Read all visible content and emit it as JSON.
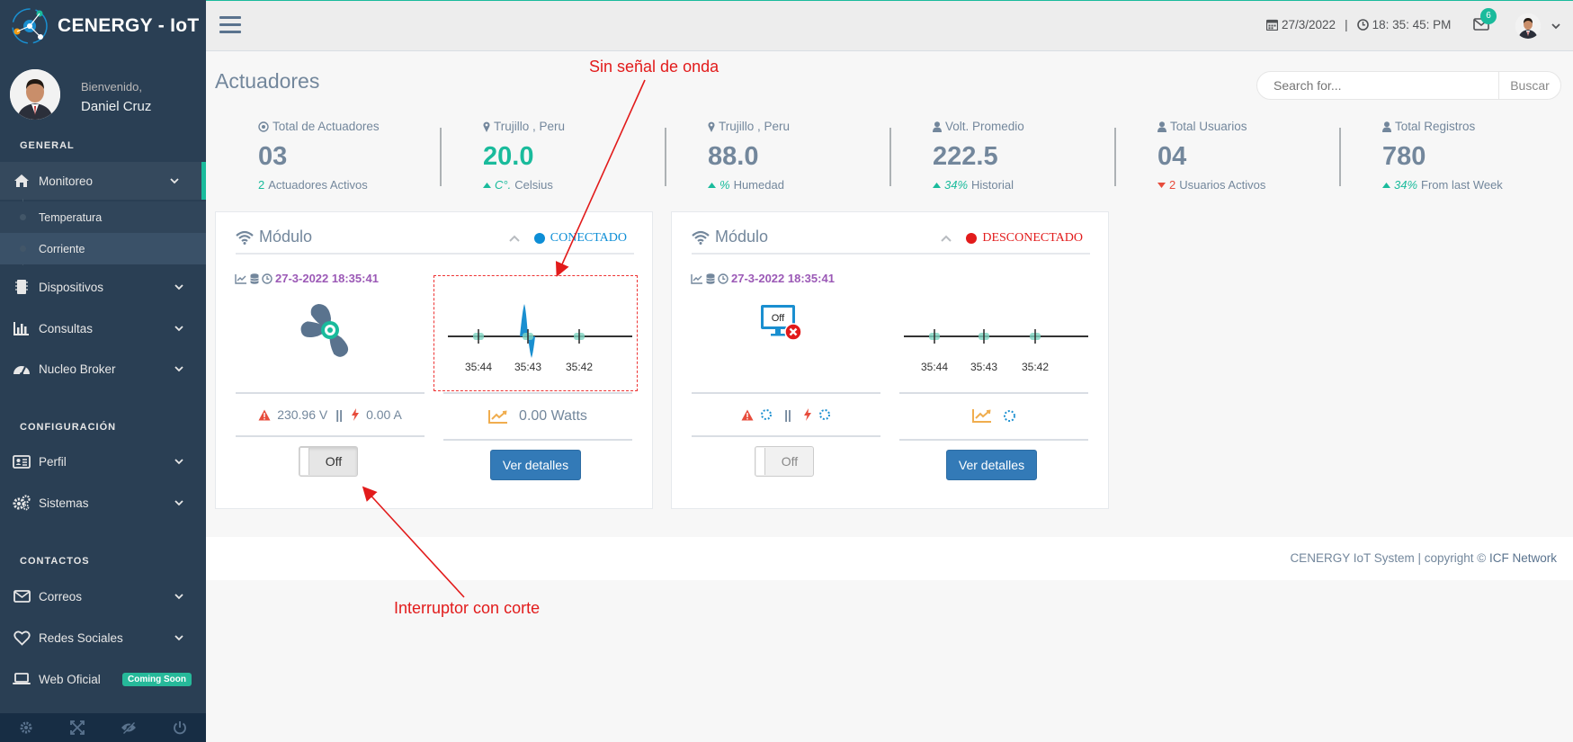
{
  "brand": {
    "title": "CENERGY - IoT"
  },
  "profile": {
    "welcome": "Bienvenido,",
    "name": "Daniel Cruz"
  },
  "sidebar": {
    "section_general": "GENERAL",
    "section_config": "CONFIGURACIÓN",
    "section_contacts": "CONTACTOS",
    "items": [
      {
        "label": "Monitoreo",
        "icon": "home-icon"
      },
      {
        "label": "Dispositivos",
        "icon": "chip-icon"
      },
      {
        "label": "Consultas",
        "icon": "bar-chart-icon"
      },
      {
        "label": "Nucleo Broker",
        "icon": "dashboard-icon"
      },
      {
        "label": "Perfil",
        "icon": "id-card-icon"
      },
      {
        "label": "Sistemas",
        "icon": "cogs-icon"
      },
      {
        "label": "Correos",
        "icon": "envelope-icon"
      },
      {
        "label": "Redes Sociales",
        "icon": "heart-icon"
      },
      {
        "label": "Web Oficial",
        "icon": "laptop-icon",
        "badge": "Coming Soon"
      }
    ],
    "subitems": [
      "Temperatura",
      "Corriente"
    ]
  },
  "topbar": {
    "date": "27/3/2022",
    "separator": "|",
    "time": "18: 35: 45: PM",
    "mail_count": "6"
  },
  "page": {
    "title": "Actuadores"
  },
  "search": {
    "placeholder": "Search for...",
    "button": "Buscar"
  },
  "tiles": [
    {
      "title": "Total de Actuadores",
      "value": "03",
      "bottom_num": "2",
      "bottom_text": "Actuadores Activos",
      "icon": "gauge-icon"
    },
    {
      "title": "Trujillo , Peru",
      "value": "20.0",
      "bottom_num": "C°.",
      "bottom_text": "Celsius",
      "icon": "map-marker-icon"
    },
    {
      "title": "Trujillo , Peru",
      "value": "88.0",
      "bottom_num": "%",
      "bottom_text": "Humedad",
      "icon": "map-marker-icon"
    },
    {
      "title": "Volt. Promedio",
      "value": "222.5",
      "bottom_num": "34%",
      "bottom_text": "Historial",
      "icon": "user-icon"
    },
    {
      "title": "Total Usuarios",
      "value": "04",
      "bottom_num": "2",
      "bottom_text": "Usuarios Activos",
      "icon": "user-icon"
    },
    {
      "title": "Total Registros",
      "value": "780",
      "bottom_num": "34%",
      "bottom_text": "From last Week",
      "icon": "user-icon"
    }
  ],
  "modules": [
    {
      "title": "Módulo",
      "status": "CONECTADO",
      "status_color": "#0d8ed6",
      "timestamp": "27-3-2022 18:35:41",
      "voltage": "230.96 V",
      "sep": "||",
      "current": "0.00 A",
      "power": "0.00 Watts",
      "toggle": "Off",
      "details_button": "Ver detalles",
      "chart_ticks": [
        "35:44",
        "35:43",
        "35:42"
      ]
    },
    {
      "title": "Módulo",
      "status": "DESCONECTADO",
      "status_color": "#e21b1b",
      "timestamp": "27-3-2022 18:35:41",
      "sep": "||",
      "monitor_label": "Off",
      "toggle": "Off",
      "details_button": "Ver detalles",
      "chart_ticks": [
        "35:44",
        "35:43",
        "35:42"
      ]
    }
  ],
  "footer": {
    "text": "CENERGY IoT System | copyright ©",
    "brand": "ICF Network"
  },
  "annotations": {
    "wave": "Sin señal de onda",
    "switch": "Interruptor con corte"
  }
}
